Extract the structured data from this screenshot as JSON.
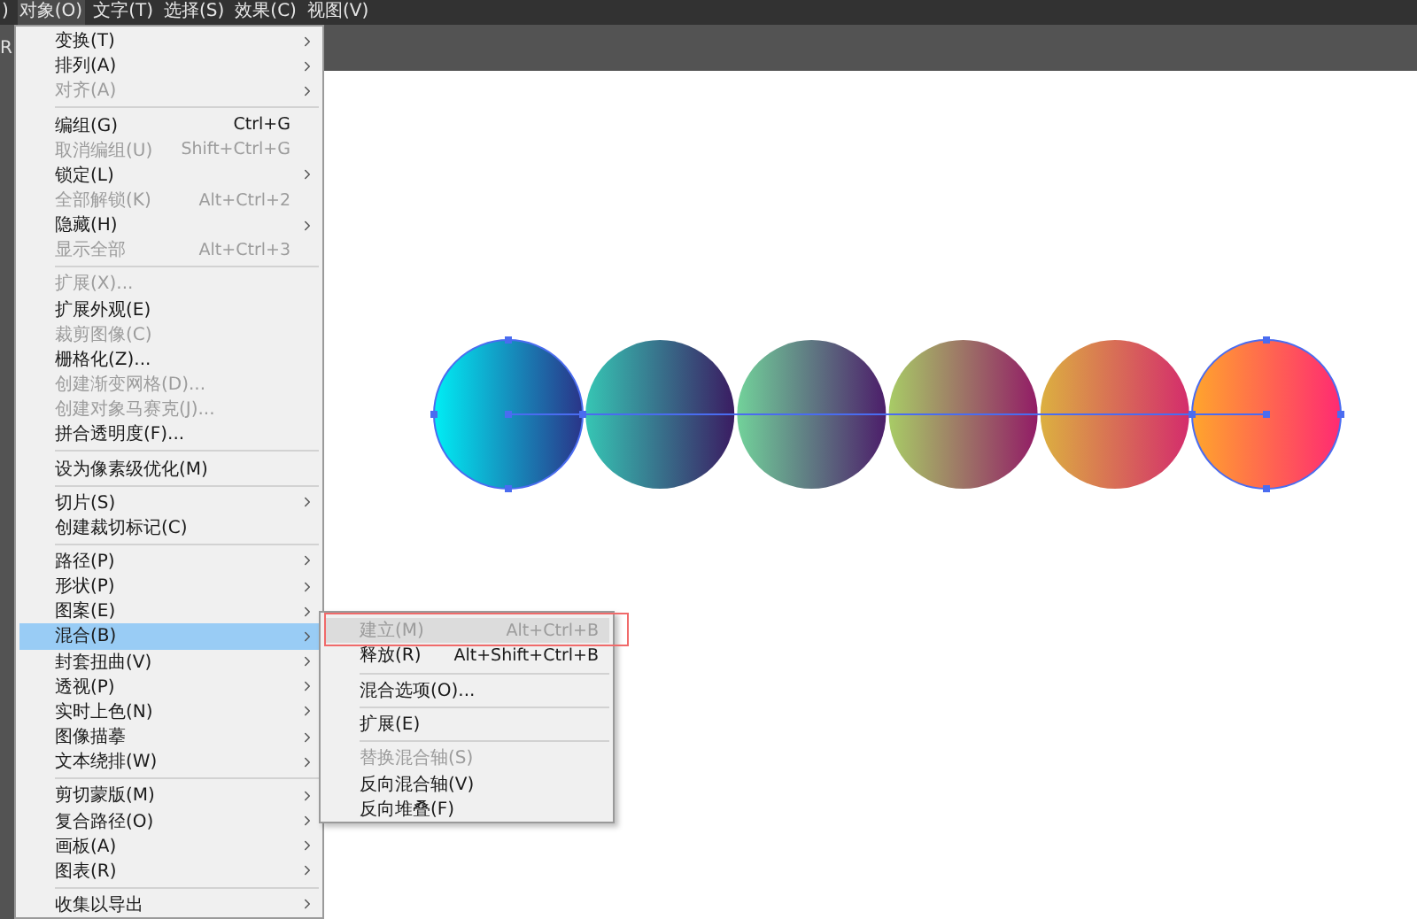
{
  "menubar": [
    {
      "label": ")",
      "selected": false
    },
    {
      "label": "对象(O)",
      "selected": true
    },
    {
      "label": "文字(T)",
      "selected": false
    },
    {
      "label": "选择(S)",
      "selected": false
    },
    {
      "label": "效果(C)",
      "selected": false
    },
    {
      "label": "视图(V)",
      "selected": false
    }
  ],
  "toolbar": {
    "text": "R"
  },
  "menu": {
    "items": [
      {
        "kind": "item",
        "label": "变换(T)",
        "submenu": true,
        "disabled": false,
        "selected": false
      },
      {
        "kind": "item",
        "label": "排列(A)",
        "submenu": true,
        "disabled": false,
        "selected": false
      },
      {
        "kind": "item",
        "label": "对齐(A)",
        "submenu": true,
        "disabled": true,
        "selected": false
      },
      {
        "kind": "separator"
      },
      {
        "kind": "item",
        "label": "编组(G)",
        "shortcut": "Ctrl+G",
        "submenu": false,
        "disabled": false,
        "selected": false
      },
      {
        "kind": "item",
        "label": "取消编组(U)",
        "shortcut": "Shift+Ctrl+G",
        "submenu": false,
        "disabled": true,
        "selected": false
      },
      {
        "kind": "item",
        "label": "锁定(L)",
        "submenu": true,
        "disabled": false,
        "selected": false
      },
      {
        "kind": "item",
        "label": "全部解锁(K)",
        "shortcut": "Alt+Ctrl+2",
        "submenu": false,
        "disabled": true,
        "selected": false
      },
      {
        "kind": "item",
        "label": "隐藏(H)",
        "submenu": true,
        "disabled": false,
        "selected": false
      },
      {
        "kind": "item",
        "label": "显示全部",
        "shortcut": "Alt+Ctrl+3",
        "submenu": false,
        "disabled": true,
        "selected": false
      },
      {
        "kind": "separator"
      },
      {
        "kind": "item",
        "label": "扩展(X)...",
        "submenu": false,
        "disabled": true,
        "selected": false
      },
      {
        "kind": "item",
        "label": "扩展外观(E)",
        "submenu": false,
        "disabled": false,
        "selected": false
      },
      {
        "kind": "item",
        "label": "裁剪图像(C)",
        "submenu": false,
        "disabled": true,
        "selected": false
      },
      {
        "kind": "item",
        "label": "栅格化(Z)...",
        "submenu": false,
        "disabled": false,
        "selected": false
      },
      {
        "kind": "item",
        "label": "创建渐变网格(D)...",
        "submenu": false,
        "disabled": true,
        "selected": false
      },
      {
        "kind": "item",
        "label": "创建对象马赛克(J)...",
        "submenu": false,
        "disabled": true,
        "selected": false
      },
      {
        "kind": "item",
        "label": "拼合透明度(F)...",
        "submenu": false,
        "disabled": false,
        "selected": false
      },
      {
        "kind": "separator"
      },
      {
        "kind": "item",
        "label": "设为像素级优化(M)",
        "submenu": false,
        "disabled": false,
        "selected": false
      },
      {
        "kind": "separator"
      },
      {
        "kind": "item",
        "label": "切片(S)",
        "submenu": true,
        "disabled": false,
        "selected": false
      },
      {
        "kind": "item",
        "label": "创建裁切标记(C)",
        "submenu": false,
        "disabled": false,
        "selected": false
      },
      {
        "kind": "separator"
      },
      {
        "kind": "item",
        "label": "路径(P)",
        "submenu": true,
        "disabled": false,
        "selected": false
      },
      {
        "kind": "item",
        "label": "形状(P)",
        "submenu": true,
        "disabled": false,
        "selected": false
      },
      {
        "kind": "item",
        "label": "图案(E)",
        "submenu": true,
        "disabled": false,
        "selected": false
      },
      {
        "kind": "item",
        "label": "混合(B)",
        "submenu": true,
        "disabled": false,
        "selected": true
      },
      {
        "kind": "item",
        "label": "封套扭曲(V)",
        "submenu": true,
        "disabled": false,
        "selected": false
      },
      {
        "kind": "item",
        "label": "透视(P)",
        "submenu": true,
        "disabled": false,
        "selected": false
      },
      {
        "kind": "item",
        "label": "实时上色(N)",
        "submenu": true,
        "disabled": false,
        "selected": false
      },
      {
        "kind": "item",
        "label": "图像描摹",
        "submenu": true,
        "disabled": false,
        "selected": false
      },
      {
        "kind": "item",
        "label": "文本绕排(W)",
        "submenu": true,
        "disabled": false,
        "selected": false
      },
      {
        "kind": "separator"
      },
      {
        "kind": "item",
        "label": "剪切蒙版(M)",
        "submenu": true,
        "disabled": false,
        "selected": false
      },
      {
        "kind": "item",
        "label": "复合路径(O)",
        "submenu": true,
        "disabled": false,
        "selected": false
      },
      {
        "kind": "item",
        "label": "画板(A)",
        "submenu": true,
        "disabled": false,
        "selected": false
      },
      {
        "kind": "item",
        "label": "图表(R)",
        "submenu": true,
        "disabled": false,
        "selected": false
      },
      {
        "kind": "separator"
      },
      {
        "kind": "item",
        "label": "收集以导出",
        "submenu": true,
        "disabled": false,
        "selected": false
      }
    ]
  },
  "submenu": {
    "items": [
      {
        "kind": "item",
        "label": "建立(M)",
        "shortcut": "Alt+Ctrl+B",
        "disabled": true,
        "selected": true,
        "framed": true
      },
      {
        "kind": "item",
        "label": "释放(R)",
        "shortcut": "Alt+Shift+Ctrl+B",
        "disabled": false,
        "selected": false,
        "framed": false
      },
      {
        "kind": "separator"
      },
      {
        "kind": "item",
        "label": "混合选项(O)...",
        "disabled": false,
        "selected": false,
        "framed": false
      },
      {
        "kind": "separator"
      },
      {
        "kind": "item",
        "label": "扩展(E)",
        "disabled": false,
        "selected": false,
        "framed": false
      },
      {
        "kind": "separator"
      },
      {
        "kind": "item",
        "label": "替换混合轴(S)",
        "disabled": true,
        "selected": false,
        "framed": false
      },
      {
        "kind": "item",
        "label": "反向混合轴(V)",
        "disabled": false,
        "selected": false,
        "framed": false
      },
      {
        "kind": "item",
        "label": "反向堆叠(F)",
        "disabled": false,
        "selected": false,
        "framed": false
      }
    ]
  },
  "artwork": {
    "circles": [
      {
        "stops": [
          {
            "color": "#00eef5"
          },
          {
            "color": "#2a3488"
          }
        ],
        "selected": true
      },
      {
        "stops": [
          {
            "color": "#36c6b4"
          },
          {
            "color": "#3a1c62"
          }
        ],
        "selected": false
      },
      {
        "stops": [
          {
            "color": "#72d29a"
          },
          {
            "color": "#4c1e6a"
          }
        ],
        "selected": false
      },
      {
        "stops": [
          {
            "color": "#a8cc66"
          },
          {
            "color": "#921c66"
          }
        ],
        "selected": false
      },
      {
        "stops": [
          {
            "color": "#dcb040"
          },
          {
            "color": "#d42c6c"
          }
        ],
        "selected": false
      },
      {
        "stops": [
          {
            "color": "#ffa62c"
          },
          {
            "color": "#ff2a72"
          }
        ],
        "selected": true
      }
    ]
  }
}
